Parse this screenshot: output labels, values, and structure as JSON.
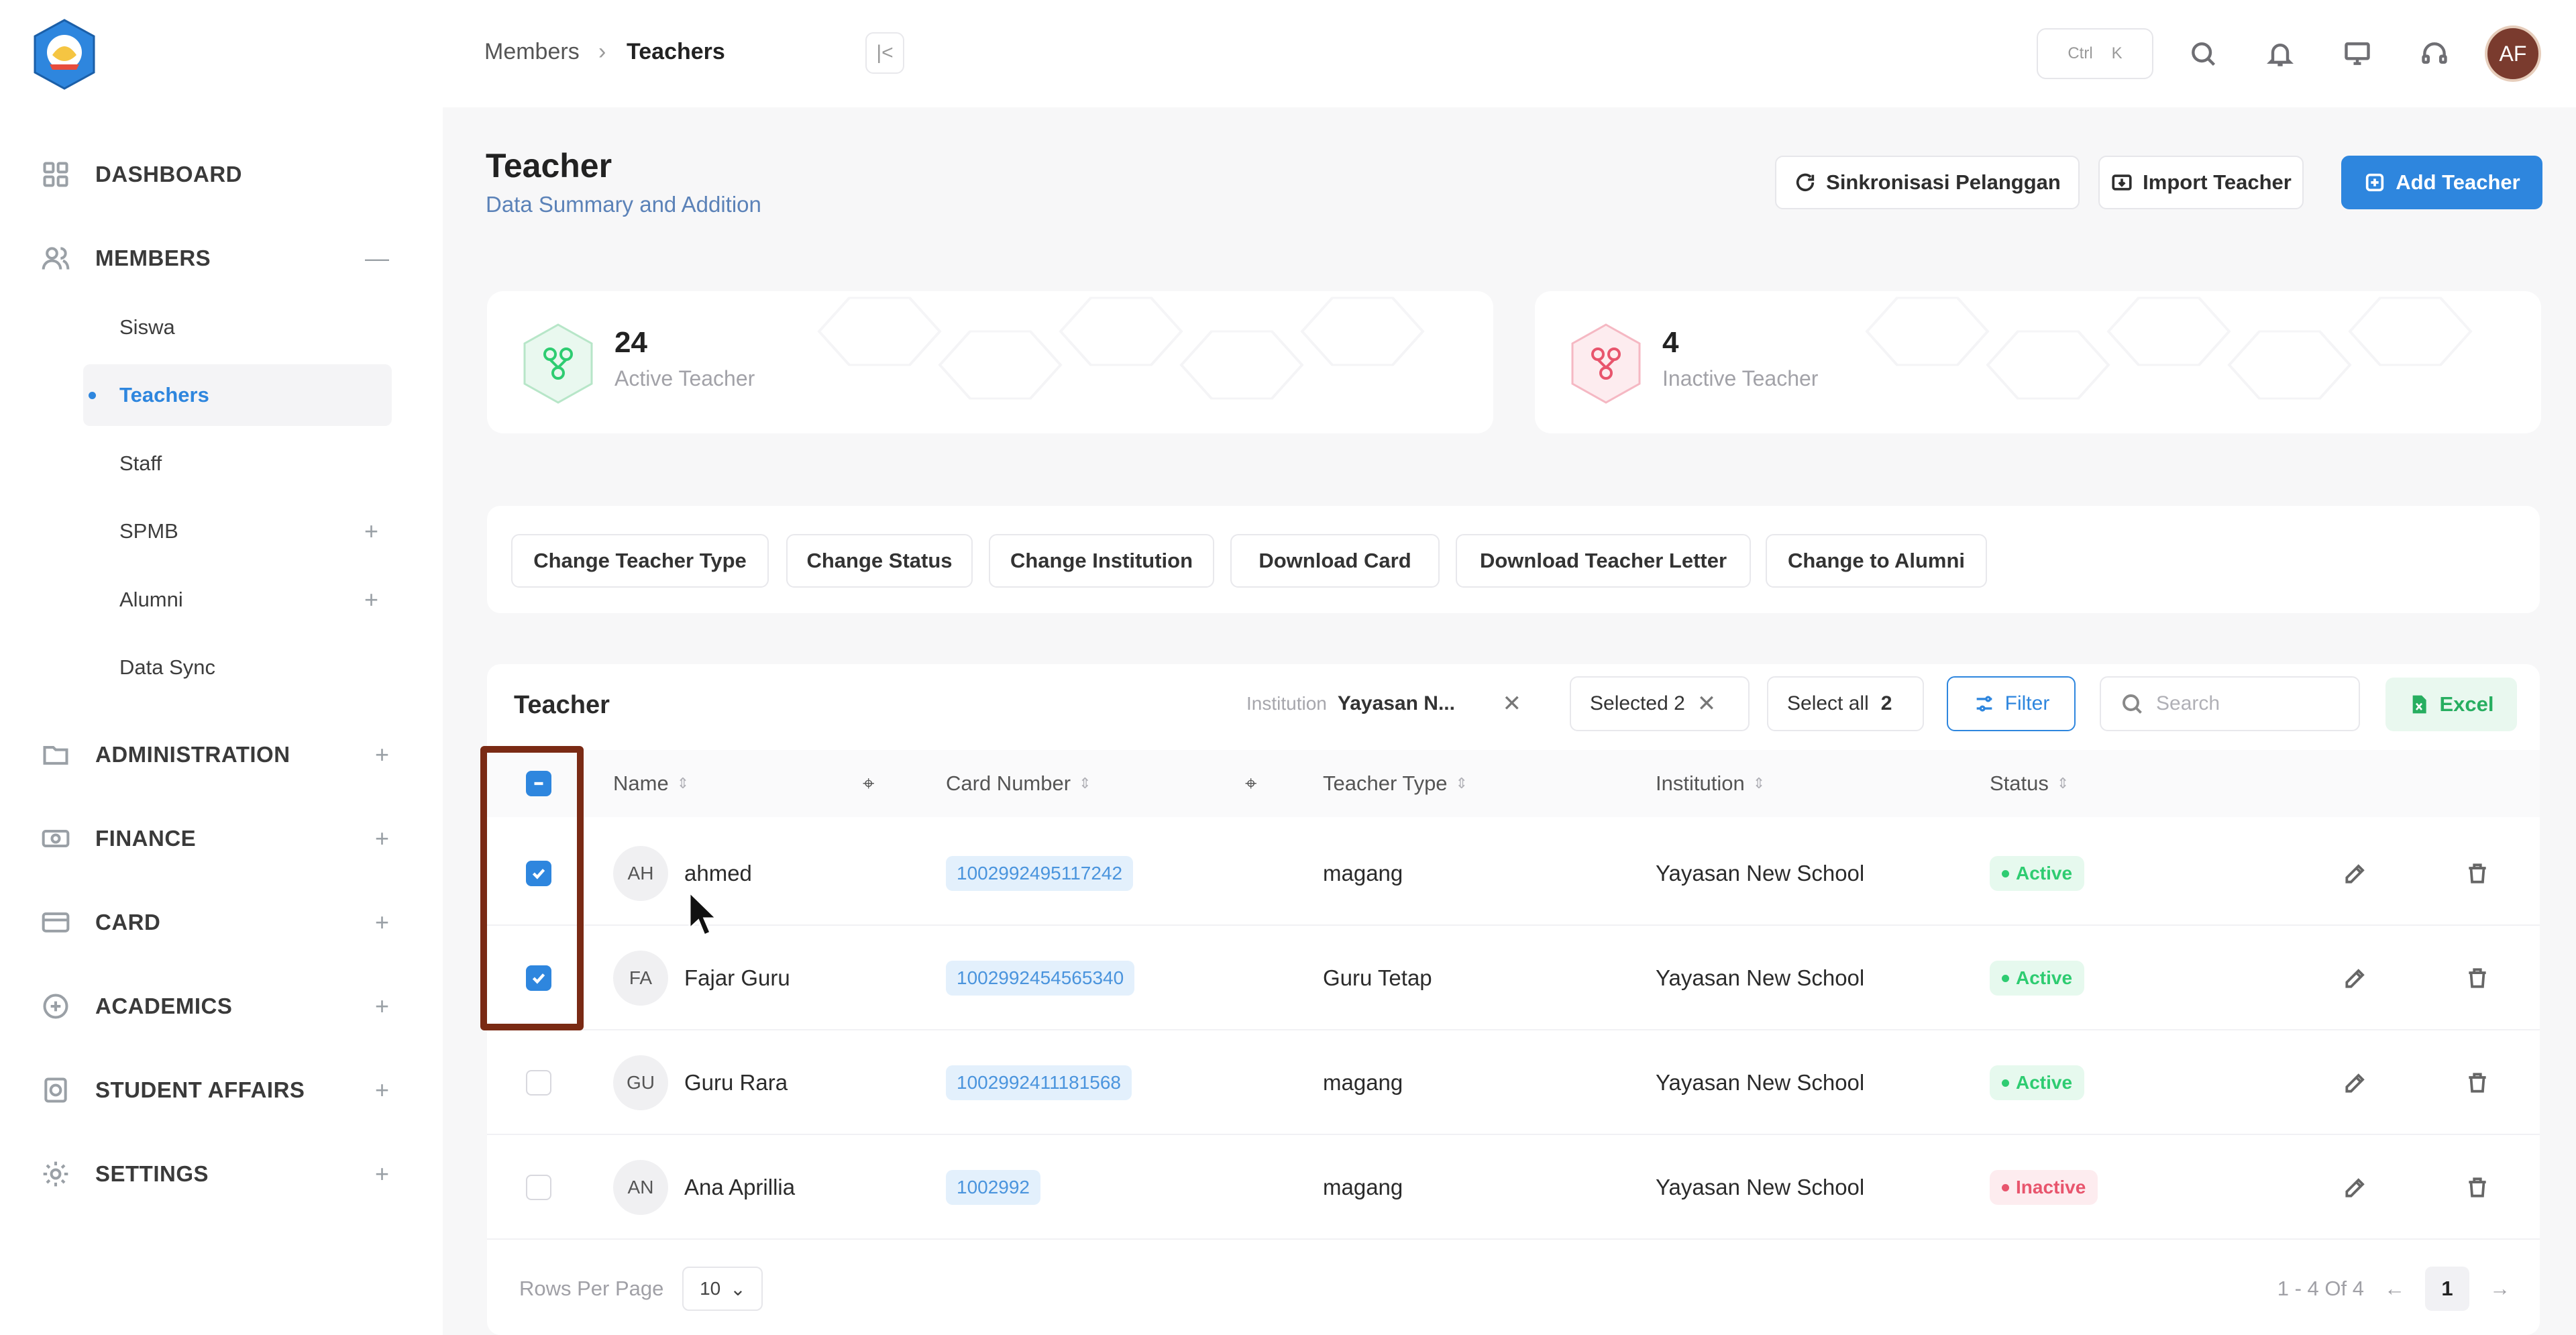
{
  "sidebar": {
    "dashboard": "DASHBOARD",
    "members": "MEMBERS",
    "members_toggle": "—",
    "members_items": [
      {
        "label": "Siswa",
        "toggle": ""
      },
      {
        "label": "Teachers",
        "toggle": ""
      },
      {
        "label": "Staff",
        "toggle": ""
      },
      {
        "label": "SPMB",
        "toggle": "+"
      },
      {
        "label": "Alumni",
        "toggle": "+"
      },
      {
        "label": "Data Sync",
        "toggle": ""
      }
    ],
    "groups": [
      {
        "label": "ADMINISTRATION",
        "toggle": "+"
      },
      {
        "label": "FINANCE",
        "toggle": "+"
      },
      {
        "label": "CARD",
        "toggle": "+"
      },
      {
        "label": "ACADEMICS",
        "toggle": "+"
      },
      {
        "label": "STUDENT AFFAIRS",
        "toggle": "+"
      },
      {
        "label": "SETTINGS",
        "toggle": "+"
      }
    ]
  },
  "topbar": {
    "breadcrumb_parent": "Members",
    "breadcrumb_separator": "›",
    "breadcrumb_current": "Teachers",
    "shortcut_ctrl": "Ctrl",
    "shortcut_key": "K",
    "collapse_glyph": "|<",
    "avatar_initials": "AF"
  },
  "header": {
    "title": "Teacher",
    "subtitle": "Data Summary and Addition",
    "sync_label": "Sinkronisasi Pelanggan",
    "import_label": "Import Teacher",
    "add_label": "Add Teacher"
  },
  "stats": [
    {
      "count": "24",
      "label": "Active Teacher"
    },
    {
      "count": "4",
      "label": "Inactive Teacher"
    }
  ],
  "bulk_actions": [
    "Change Teacher Type",
    "Change Status",
    "Change Institution",
    "Download Card",
    "Download Teacher Letter",
    "Change to Alumni"
  ],
  "table": {
    "title": "Teacher",
    "institution_filter_label": "Institution",
    "institution_filter_value": "Yayasan N...",
    "selected_label": "Selected 2",
    "select_all_label": "Select all",
    "select_all_count": "2",
    "filter_label": "Filter",
    "search_placeholder": "Search",
    "excel_label": "Excel",
    "columns": [
      "Name",
      "Card Number",
      "Teacher Type",
      "Institution",
      "Status"
    ],
    "rows": [
      {
        "initials": "AH",
        "name": "ahmed",
        "card": "1002992495117242",
        "type": "magang",
        "institution": "Yayasan New School",
        "status": "Active",
        "checked": true
      },
      {
        "initials": "FA",
        "name": "Fajar Guru",
        "card": "1002992454565340",
        "type": "Guru Tetap",
        "institution": "Yayasan New School",
        "status": "Active",
        "checked": true
      },
      {
        "initials": "GU",
        "name": "Guru Rara",
        "card": "1002992411181568",
        "type": "magang",
        "institution": "Yayasan New School",
        "status": "Active",
        "checked": false
      },
      {
        "initials": "AN",
        "name": "Ana Aprillia",
        "card": "1002992",
        "type": "magang",
        "institution": "Yayasan New School",
        "status": "Inactive",
        "checked": false
      }
    ],
    "rows_per_page_label": "Rows Per Page",
    "rows_per_page_value": "10",
    "range_label": "1 - 4 Of 4",
    "current_page": "1",
    "prev_glyph": "←",
    "next_glyph": "→"
  },
  "colors": {
    "primary": "#2e86de",
    "active_green": "#2ecc71",
    "inactive_red": "#e8556d",
    "highlight_box": "#7a2a14"
  }
}
